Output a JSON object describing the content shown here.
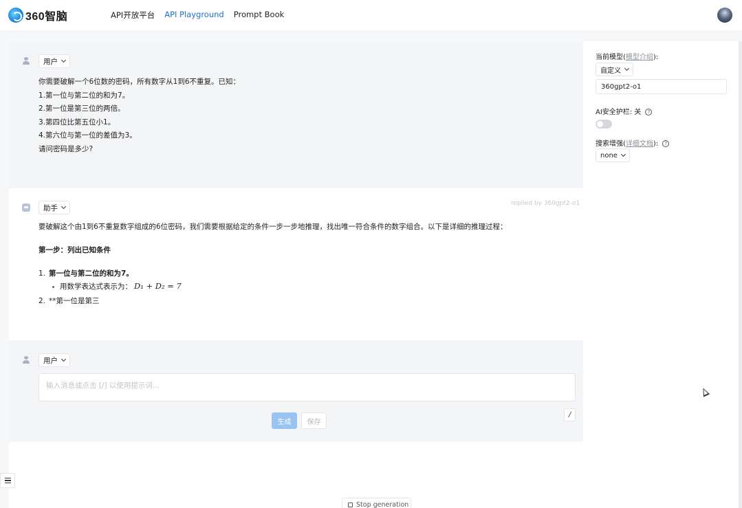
{
  "brand": {
    "logo_text": "360智脑"
  },
  "nav": {
    "items": [
      {
        "label": "API开放平台",
        "active": false
      },
      {
        "label": "API Playground",
        "active": true
      },
      {
        "label": "Prompt Book",
        "active": false
      }
    ]
  },
  "messages": {
    "user": {
      "role_label": "用户",
      "lines": [
        "你需要破解一个6位数的密码，所有数字从1到6不重复。已知：",
        "1.第一位与第二位的和为7。",
        "2.第一位是第三位的两倍。",
        "3.第四位比第五位小1。",
        "4.第六位与第一位的差值为3。",
        "请问密码是多少?"
      ]
    },
    "assistant": {
      "role_label": "助手",
      "replied_by": "replied by 360gpt2-o1",
      "intro": "要破解这个由1到6不重复数字组成的6位密码，我们需要根据给定的条件一步一步地推理，找出唯一符合条件的数字组合。以下是详细的推理过程：",
      "step_heading": "第一步：列出已知条件",
      "item1_num": "1.",
      "item1_text": "第一位与第二位的和为7。",
      "item1_sub": "用数学表达式表示为：",
      "item1_formula": "D₁ + D₂ = 7",
      "item2_num": "2.",
      "item2_text": "**第一位是第三"
    },
    "composer": {
      "role_label": "用户",
      "placeholder": "输入消息或点击 [/] 以使用提示词...",
      "generate_label": "生成",
      "save_label": "保存",
      "slash_label": "/"
    }
  },
  "sidebar": {
    "model_label_prefix": "当前模型(",
    "model_label_link": "模型介绍",
    "model_label_suffix": "):",
    "model_mode": "自定义",
    "model_value": "360gpt2-o1",
    "safety_label": "AI安全护栏: 关",
    "safety_on": false,
    "search_label_prefix": "搜索增强(",
    "search_label_link": "详细文档",
    "search_label_suffix": "):",
    "search_value": "none"
  },
  "footer": {
    "stop_label": "Stop generation"
  },
  "icons": {
    "menu": "hamburger-icon",
    "help": "question-circle-icon",
    "cursor": "mouse-pointer-icon"
  }
}
